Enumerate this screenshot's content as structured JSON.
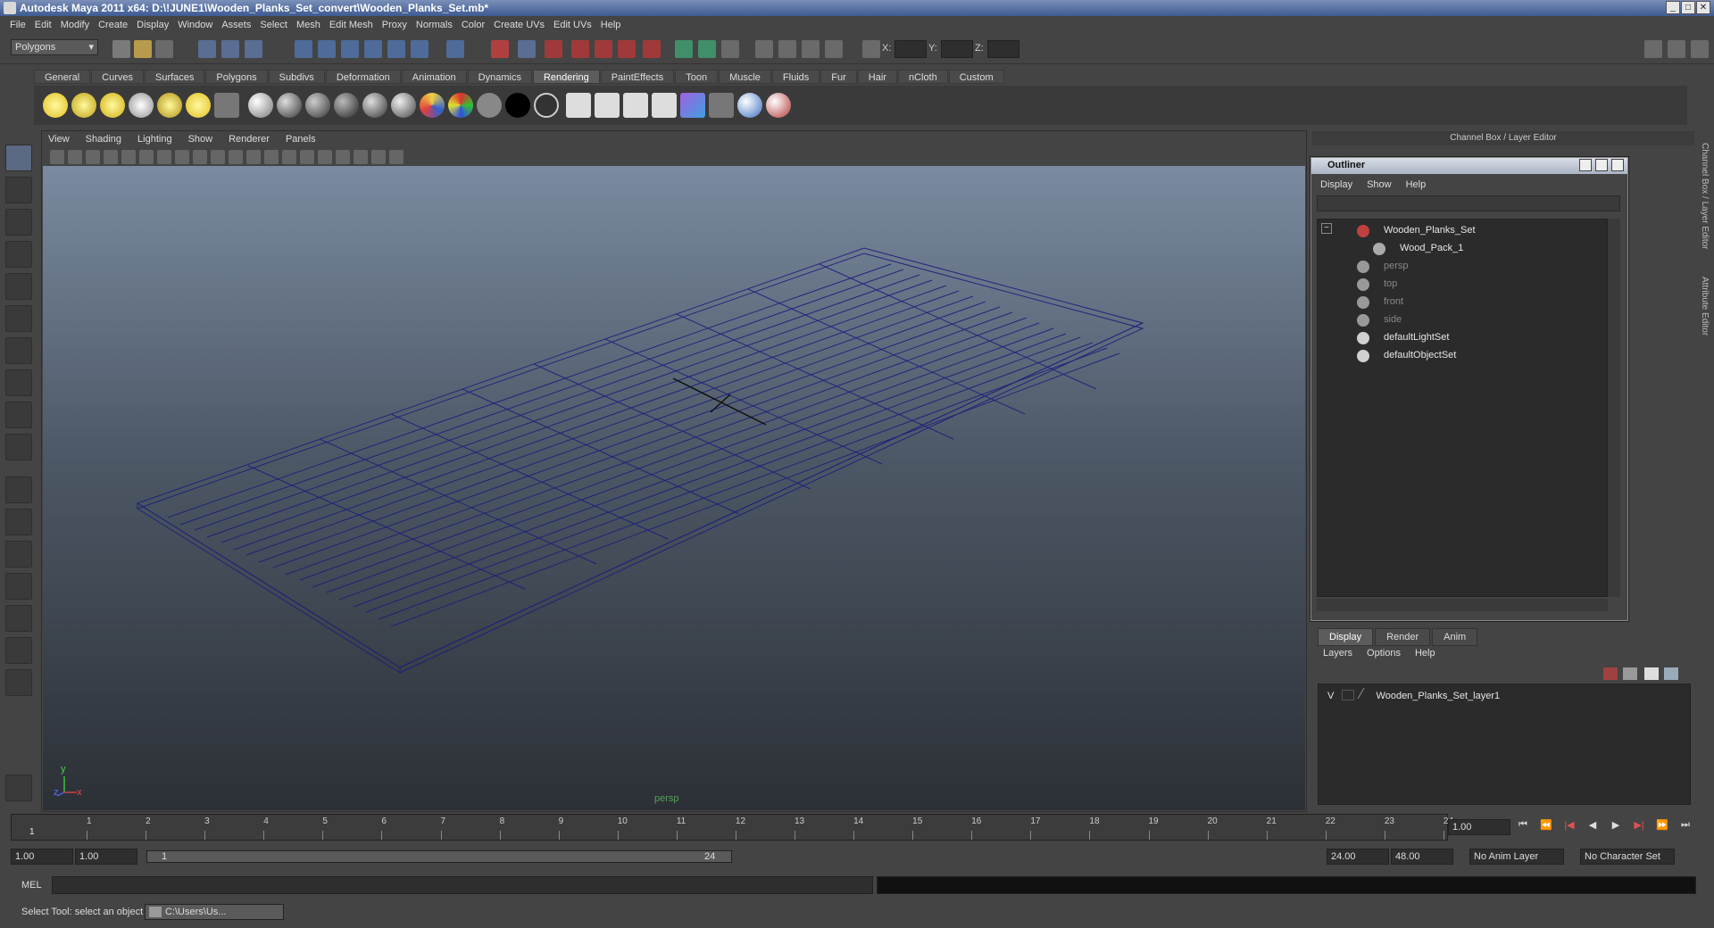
{
  "window": {
    "title": "Autodesk Maya 2011 x64: D:\\!JUNE1\\Wooden_Planks_Set_convert\\Wooden_Planks_Set.mb*",
    "min": "_",
    "max": "□",
    "close": "✕"
  },
  "menus": [
    "File",
    "Edit",
    "Modify",
    "Create",
    "Display",
    "Window",
    "Assets",
    "Select",
    "Mesh",
    "Edit Mesh",
    "Proxy",
    "Normals",
    "Color",
    "Create UVs",
    "Edit UVs",
    "Help"
  ],
  "status": {
    "mode": "Polygons",
    "x_label": "X:",
    "y_label": "Y:",
    "z_label": "Z:"
  },
  "shelf_tabs": [
    "General",
    "Curves",
    "Surfaces",
    "Polygons",
    "Subdivs",
    "Deformation",
    "Animation",
    "Dynamics",
    "Rendering",
    "PaintEffects",
    "Toon",
    "Muscle",
    "Fluids",
    "Fur",
    "Hair",
    "nCloth",
    "Custom"
  ],
  "shelf_active": "Rendering",
  "viewport": {
    "menus": [
      "View",
      "Shading",
      "Lighting",
      "Show",
      "Renderer",
      "Panels"
    ],
    "camera_label": "persp",
    "axis_y": "y",
    "axis_x": "x",
    "axis_z": "z"
  },
  "channel_box": {
    "title": "Channel Box / Layer Editor"
  },
  "side_tabs": {
    "channel_box": "Channel Box / Layer Editor",
    "attribute_editor": "Attribute Editor"
  },
  "outliner": {
    "title": "Outliner",
    "menus": [
      "Display",
      "Show",
      "Help"
    ],
    "items": [
      {
        "label": "Wooden_Planks_Set",
        "indent": 0,
        "dim": false,
        "icon": "mesh-icon"
      },
      {
        "label": "Wood_Pack_1",
        "indent": 1,
        "dim": false,
        "icon": "shape-icon"
      },
      {
        "label": "persp",
        "indent": 0,
        "dim": true,
        "icon": "camera-icon"
      },
      {
        "label": "top",
        "indent": 0,
        "dim": true,
        "icon": "camera-icon"
      },
      {
        "label": "front",
        "indent": 0,
        "dim": true,
        "icon": "camera-icon"
      },
      {
        "label": "side",
        "indent": 0,
        "dim": true,
        "icon": "camera-icon"
      },
      {
        "label": "defaultLightSet",
        "indent": 0,
        "dim": false,
        "icon": "set-icon"
      },
      {
        "label": "defaultObjectSet",
        "indent": 0,
        "dim": false,
        "icon": "set-icon"
      }
    ],
    "collapse_glyph": "−"
  },
  "layer_editor": {
    "tabs": [
      "Display",
      "Render",
      "Anim"
    ],
    "active_tab": "Display",
    "menus": [
      "Layers",
      "Options",
      "Help"
    ],
    "layers": [
      {
        "visible": "V",
        "name": "Wooden_Planks_Set_layer1"
      }
    ]
  },
  "timeline": {
    "ticks": [
      "1",
      "2",
      "3",
      "4",
      "5",
      "6",
      "7",
      "8",
      "9",
      "10",
      "11",
      "12",
      "13",
      "14",
      "15",
      "16",
      "17",
      "18",
      "19",
      "20",
      "21",
      "22",
      "23",
      "24"
    ],
    "current_frame": "1",
    "current_frame_field": "1.00"
  },
  "playback": {
    "goto_start": "⏮",
    "step_back_key": "⏪",
    "step_back": "|◀",
    "play_back": "◀",
    "play_fwd": "▶",
    "step_fwd": "▶|",
    "step_fwd_key": "⏩",
    "goto_end": "⏭"
  },
  "range": {
    "start": "1.00",
    "playback_start": "1.00",
    "slider_start": "1",
    "slider_end": "24",
    "playback_end": "24.00",
    "end": "48.00",
    "anim_layer": "No Anim Layer",
    "character_set": "No Character Set"
  },
  "mel": {
    "label": "MEL"
  },
  "help_line": {
    "text": "Select Tool: select an object",
    "task_button": "C:\\Users\\Us..."
  }
}
